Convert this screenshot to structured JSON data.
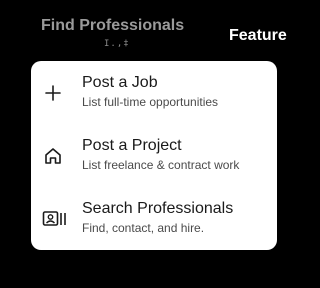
{
  "nav": {
    "find_label": "Find Professionals",
    "feature_label": "Feature",
    "cursor_glyph": "I.,‡"
  },
  "menu": {
    "items": [
      {
        "title": "Post a Job",
        "subtitle": "List full-time opportunities",
        "icon": "plus-icon"
      },
      {
        "title": "Post a Project",
        "subtitle": "List freelance & contract work",
        "icon": "home-icon"
      },
      {
        "title": "Search Professionals",
        "subtitle": "Find, contact, and hire.",
        "icon": "contact-card-icon"
      }
    ]
  },
  "colors": {
    "background": "#000000",
    "card": "#ffffff",
    "nav_inactive": "#9a9a9a",
    "nav_active": "#ffffff"
  }
}
